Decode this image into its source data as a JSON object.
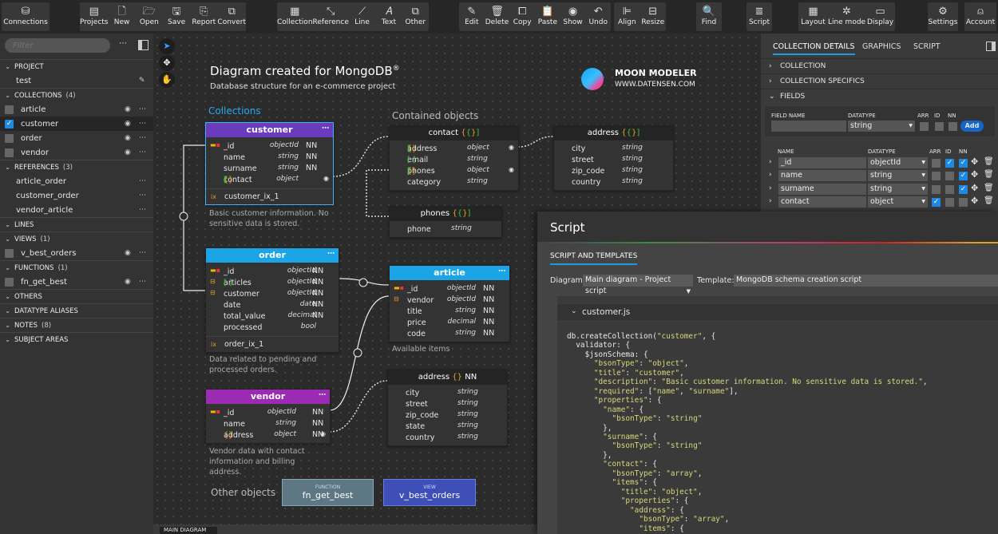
{
  "toolbar": {
    "groups": [
      [
        {
          "label": "Connections",
          "icon": "⛁"
        }
      ],
      [
        {
          "label": "Projects",
          "icon": "▤"
        },
        {
          "label": "New",
          "icon": "🗋"
        },
        {
          "label": "Open",
          "icon": "🗁"
        },
        {
          "label": "Save",
          "icon": "🖫"
        },
        {
          "label": "Report",
          "icon": "⎘"
        },
        {
          "label": "Convert",
          "icon": "⧉"
        }
      ],
      [
        {
          "label": "Collection",
          "icon": "▦"
        },
        {
          "label": "Reference",
          "icon": "⤡"
        },
        {
          "label": "Line",
          "icon": "⟋"
        },
        {
          "label": "Text",
          "icon": "𝐴"
        },
        {
          "label": "Other",
          "icon": "⧉"
        }
      ],
      [
        {
          "label": "Edit",
          "icon": "✎"
        },
        {
          "label": "Delete",
          "icon": "🗑"
        },
        {
          "label": "Copy",
          "icon": "⧠"
        },
        {
          "label": "Paste",
          "icon": "📋"
        },
        {
          "label": "Show",
          "icon": "◉"
        },
        {
          "label": "Undo",
          "icon": "↶"
        }
      ],
      [
        {
          "label": "Align",
          "icon": "⊫"
        },
        {
          "label": "Resize",
          "icon": "⊟"
        }
      ],
      [
        {
          "label": "Find",
          "icon": "🔍"
        }
      ],
      [
        {
          "label": "Script",
          "icon": "≣"
        }
      ],
      [
        {
          "label": "Layout",
          "icon": "▦"
        },
        {
          "label": "Line mode",
          "icon": "✲"
        },
        {
          "label": "Display",
          "icon": "▭"
        }
      ],
      [
        {
          "label": "Settings",
          "icon": "⚙"
        }
      ],
      [
        {
          "label": "Account",
          "icon": "⍝"
        }
      ]
    ]
  },
  "sidebar": {
    "filter_placeholder": "Filter",
    "project": {
      "label": "PROJECT",
      "name": "test"
    },
    "collections": {
      "label": "COLLECTIONS",
      "count": "(4)",
      "items": [
        "article",
        "customer",
        "order",
        "vendor"
      ]
    },
    "references": {
      "label": "REFERENCES",
      "count": "(3)",
      "items": [
        "article_order",
        "customer_order",
        "vendor_article"
      ]
    },
    "lines": {
      "label": "LINES"
    },
    "views": {
      "label": "VIEWS",
      "count": "(1)",
      "items": [
        "v_best_orders"
      ]
    },
    "functions": {
      "label": "FUNCTIONS",
      "count": "(1)",
      "items": [
        "fn_get_best"
      ]
    },
    "others": {
      "label": "OTHERS"
    },
    "aliases": {
      "label": "DATATYPE ALIASES"
    },
    "notes": {
      "label": "NOTES",
      "count": "(8)"
    },
    "subject_areas": {
      "label": "SUBJECT AREAS"
    }
  },
  "diagram": {
    "title": "Diagram created for MongoDB",
    "reg": "®",
    "subtitle": "Database structure for an e-commerce project",
    "brand": "MOON MODELER",
    "brand_url": "WWW.DATENSEN.COM",
    "collections_label": "Collections",
    "contained_label": "Contained objects",
    "other_label": "Other objects",
    "customer": {
      "name": "customer",
      "color": "#6a3bbd",
      "fields": [
        [
          "_id",
          "objectId",
          "NN"
        ],
        [
          "name",
          "string",
          "NN"
        ],
        [
          "surname",
          "string",
          "NN"
        ],
        [
          "contact",
          "object",
          ""
        ]
      ],
      "index": "customer_ix_1",
      "note": "Basic customer information. No sensitive data is stored."
    },
    "order": {
      "name": "order",
      "color": "#1ba5e6",
      "fields": [
        [
          "_id",
          "objectId",
          "NN"
        ],
        [
          "articles",
          "objectId",
          "NN"
        ],
        [
          "customer",
          "objectId",
          "NN"
        ],
        [
          "date",
          "date",
          "NN"
        ],
        [
          "total_value",
          "decimal",
          "NN"
        ],
        [
          "processed",
          "bool",
          ""
        ]
      ],
      "index": "order_ix_1",
      "note": "Data related to pending and processed orders."
    },
    "vendor": {
      "name": "vendor",
      "color": "#9c2bb4",
      "fields": [
        [
          "_id",
          "objectId",
          "NN"
        ],
        [
          "name",
          "string",
          "NN"
        ],
        [
          "address",
          "object",
          "NN"
        ]
      ],
      "note": "Vendor data with contact information and billing address."
    },
    "article": {
      "name": "article",
      "color": "#1ba5e6",
      "fields": [
        [
          "_id",
          "objectId",
          "NN"
        ],
        [
          "vendor",
          "objectId",
          "NN"
        ],
        [
          "title",
          "string",
          "NN"
        ],
        [
          "price",
          "decimal",
          "NN"
        ],
        [
          "code",
          "string",
          "NN"
        ]
      ],
      "note": "Available items"
    },
    "contact": {
      "name": "contact",
      "fields": [
        [
          "address",
          "object"
        ],
        [
          "email",
          "string"
        ],
        [
          "phones",
          "object"
        ],
        [
          "category",
          "string"
        ]
      ]
    },
    "address_top": {
      "name": "address",
      "fields": [
        [
          "city",
          "string"
        ],
        [
          "street",
          "string"
        ],
        [
          "zip_code",
          "string"
        ],
        [
          "country",
          "string"
        ]
      ]
    },
    "phones": {
      "name": "phones",
      "fields": [
        [
          "phone",
          "string"
        ]
      ]
    },
    "address_vendor": {
      "name": "address",
      "nn": "NN",
      "fields": [
        [
          "city",
          "string"
        ],
        [
          "street",
          "string"
        ],
        [
          "zip_code",
          "string"
        ],
        [
          "state",
          "string"
        ],
        [
          "country",
          "string"
        ]
      ]
    },
    "function": {
      "type": "FUNCTION",
      "name": "fn_get_best",
      "color": "#5d7884"
    },
    "view": {
      "type": "VIEW",
      "name": "v_best_orders",
      "color": "#3f4fb8"
    },
    "tab": "MAIN DIAGRAM"
  },
  "right": {
    "tabs": [
      "COLLECTION DETAILS",
      "GRAPHICS",
      "SCRIPT"
    ],
    "sections": [
      "COLLECTION",
      "COLLECTION SPECIFICS",
      "FIELDS"
    ],
    "new_field": {
      "name_label": "FIELD NAME",
      "type_label": "DATATYPE",
      "arr": "ARR",
      "id": "ID",
      "nn": "NN",
      "type_value": "string",
      "add": "Add"
    },
    "cols": {
      "name": "NAME",
      "type": "DATATYPE",
      "arr": "ARR",
      "id": "ID",
      "nn": "NN"
    },
    "fields": [
      {
        "name": "_id",
        "type": "objectId",
        "arr": false,
        "id": true,
        "nn": true
      },
      {
        "name": "name",
        "type": "string",
        "arr": false,
        "id": false,
        "nn": true
      },
      {
        "name": "surname",
        "type": "string",
        "arr": false,
        "id": false,
        "nn": true
      },
      {
        "name": "contact",
        "type": "object",
        "arr": true,
        "id": false,
        "nn": false
      }
    ]
  },
  "script": {
    "title": "Script",
    "tab": "SCRIPT AND TEMPLATES",
    "diagram_label": "Diagram:",
    "diagram_value": "Main diagram - Project script",
    "template_label": "Template:",
    "template_value": "MongoDB schema creation script",
    "file": "customer.js",
    "code": [
      "db.createCollection(\"customer\", {",
      "  validator: {",
      "    $jsonSchema: {",
      "      \"bsonType\": \"object\",",
      "      \"title\": \"customer\",",
      "      \"description\": \"Basic customer information. No sensitive data is stored.\",",
      "      \"required\": [\"name\", \"surname\"],",
      "      \"properties\": {",
      "        \"name\": {",
      "          \"bsonType\": \"string\"",
      "        },",
      "        \"surname\": {",
      "          \"bsonType\": \"string\"",
      "        },",
      "        \"contact\": {",
      "          \"bsonType\": \"array\",",
      "          \"items\": {",
      "            \"title\": \"object\",",
      "            \"properties\": {",
      "              \"address\": {",
      "                \"bsonType\": \"array\",",
      "                \"items\": {"
    ]
  }
}
